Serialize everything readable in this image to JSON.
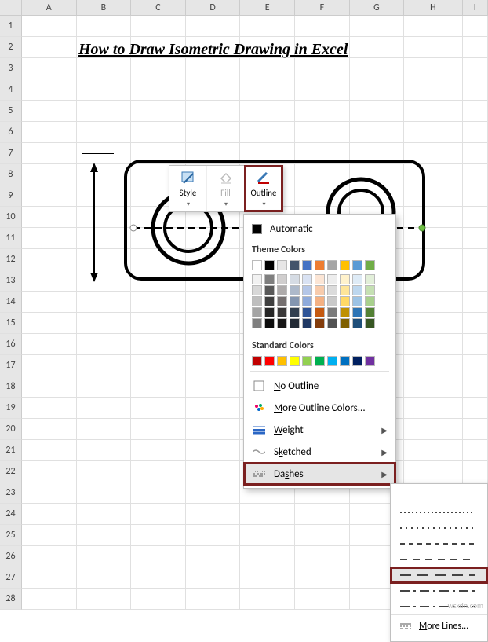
{
  "columns": [
    "A",
    "B",
    "C",
    "D",
    "E",
    "F",
    "G",
    "H",
    "I"
  ],
  "rows": [
    "1",
    "2",
    "3",
    "4",
    "5",
    "6",
    "7",
    "8",
    "9",
    "10",
    "11",
    "12",
    "13",
    "14",
    "15",
    "16",
    "17",
    "18",
    "19",
    "20",
    "21",
    "22",
    "23",
    "24",
    "25",
    "26",
    "27",
    "28"
  ],
  "title": "How to Draw Isometric Drawing in Excel",
  "toolbar": {
    "style": "Style",
    "fill": "Fill",
    "outline": "Outline"
  },
  "menu": {
    "automatic": "Automatic",
    "theme_colors": "Theme Colors",
    "standard_colors": "Standard Colors",
    "no_outline": "No Outline",
    "more_colors": "More Outline Colors...",
    "weight": "Weight",
    "sketched": "Sketched",
    "dashes": "Dashes",
    "more_lines": "More Lines..."
  },
  "theme_base": [
    "#ffffff",
    "#000000",
    "#e7e6e6",
    "#44546a",
    "#4472c4",
    "#ed7d31",
    "#a5a5a5",
    "#ffc000",
    "#5b9bd5",
    "#70ad47"
  ],
  "theme_tints": [
    [
      "#f2f2f2",
      "#7f7f7f",
      "#d0cece",
      "#d6dce4",
      "#d9e2f3",
      "#fbe5d5",
      "#ededed",
      "#fff2cc",
      "#deebf6",
      "#e2efd9"
    ],
    [
      "#d8d8d8",
      "#595959",
      "#aeabab",
      "#adb9ca",
      "#b4c6e7",
      "#f7cbac",
      "#dbdbdb",
      "#fee599",
      "#bdd7ee",
      "#c5e0b3"
    ],
    [
      "#bfbfbf",
      "#3f3f3f",
      "#757070",
      "#8496b0",
      "#8eaadb",
      "#f4b183",
      "#c9c9c9",
      "#ffd965",
      "#9cc3e5",
      "#a8d08d"
    ],
    [
      "#a5a5a5",
      "#262626",
      "#3a3838",
      "#323f4f",
      "#2f5496",
      "#c55a11",
      "#7b7b7b",
      "#bf9000",
      "#2e75b5",
      "#538135"
    ],
    [
      "#7f7f7f",
      "#0c0c0c",
      "#171616",
      "#222a35",
      "#1f3864",
      "#833c0b",
      "#525252",
      "#7f6000",
      "#1e4e79",
      "#375623"
    ]
  ],
  "standard": [
    "#c00000",
    "#ff0000",
    "#ffc000",
    "#ffff00",
    "#92d050",
    "#00b050",
    "#00b0f0",
    "#0070c0",
    "#002060",
    "#7030a0"
  ],
  "watermark": "wsxdn.com"
}
